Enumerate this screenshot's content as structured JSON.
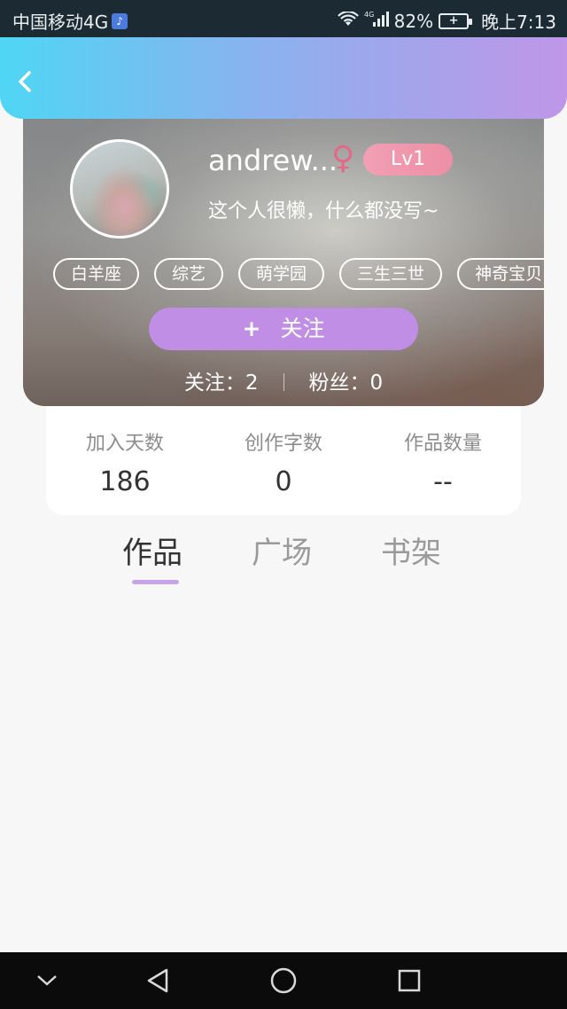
{
  "status_bar": {
    "carrier": "中国移动4G",
    "battery_percent": "82%",
    "time": "晚上7:13",
    "icons": [
      "music-app-icon",
      "wifi-icon",
      "4g-signal-icon",
      "battery-charging-icon"
    ]
  },
  "header": {
    "back_icon": "chevron-left-icon"
  },
  "profile": {
    "username": "andrew...",
    "gender_symbol": "♀",
    "level": "Lv1",
    "bio": "这个人很懒，什么都没写~",
    "tags": [
      "白羊座",
      "综艺",
      "萌学园",
      "三生三世",
      "神奇宝贝"
    ],
    "follow_button": {
      "plus": "+",
      "label": "关注"
    },
    "following": "关注：2",
    "followers": "粉丝：0"
  },
  "stats": [
    {
      "label": "加入天数",
      "value": "186"
    },
    {
      "label": "创作字数",
      "value": "0"
    },
    {
      "label": "作品数量",
      "value": "--"
    }
  ],
  "tabs": [
    {
      "label": "作品",
      "active": true
    },
    {
      "label": "广场",
      "active": false
    },
    {
      "label": "书架",
      "active": false
    }
  ],
  "nav_bar": {
    "icons": [
      "chevron-down-icon",
      "back-triangle-icon",
      "home-circle-icon",
      "recents-square-icon"
    ]
  },
  "colors": {
    "header_gradient": [
      "#4fd6f4",
      "#8ab2ee",
      "#bf96e8"
    ],
    "accent_purple": "#c08ee4",
    "level_pink": "#f29fb4",
    "gender_pink": "#e36a86"
  }
}
